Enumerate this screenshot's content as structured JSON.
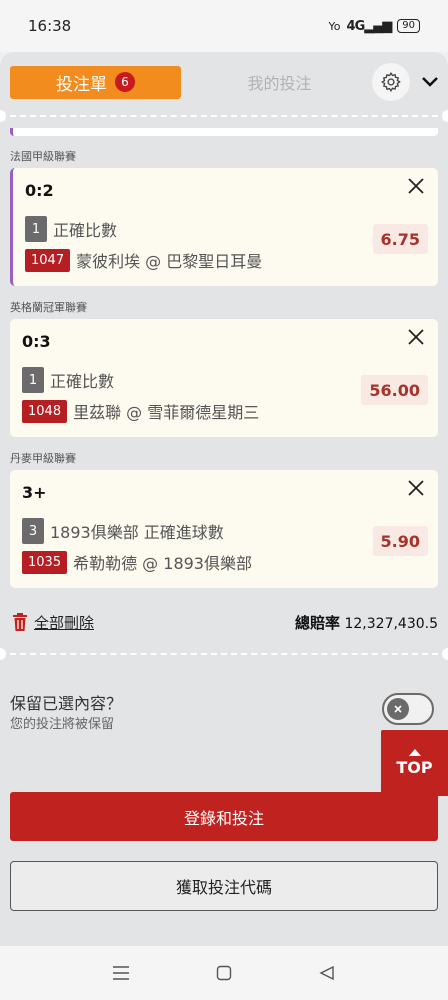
{
  "status": {
    "time": "16:38",
    "network": "4G",
    "battery": "90"
  },
  "header": {
    "tab_betslip": "投注單",
    "badge_count": "6",
    "tab_mybets": "我的投注"
  },
  "bets": [
    {
      "league": "法國甲級聯賽",
      "selection": "0:2",
      "leg_no": "1",
      "bet_type": "正確比數",
      "match_no": "1047",
      "match": "蒙彼利埃 @ 巴黎聖日耳曼",
      "odds": "6.75"
    },
    {
      "league": "英格蘭冠軍聯賽",
      "selection": "0:3",
      "leg_no": "1",
      "bet_type": "正確比數",
      "match_no": "1048",
      "match": "里茲聯 @ 雪菲爾德星期三",
      "odds": "56.00"
    },
    {
      "league": "丹麥甲級聯賽",
      "selection": "3+",
      "leg_no": "3",
      "bet_type": "1893俱樂部 正確進球數",
      "match_no": "1035",
      "match": "希勒勒德 @ 1893俱樂部",
      "odds": "5.90"
    }
  ],
  "footer": {
    "delete_all": "全部刪除",
    "total_odds_label": "總賠率",
    "total_odds_value": "12,327,430.5"
  },
  "keep": {
    "title": "保留已選內容？",
    "subtitle": "您的投注將被保留"
  },
  "top_button": "TOP",
  "login_button": "登錄和投注",
  "code_button": "獲取投注代碼",
  "colors": {
    "accent_orange": "#f28c1e",
    "accent_red": "#c0221f",
    "odds_text": "#a8332b"
  }
}
